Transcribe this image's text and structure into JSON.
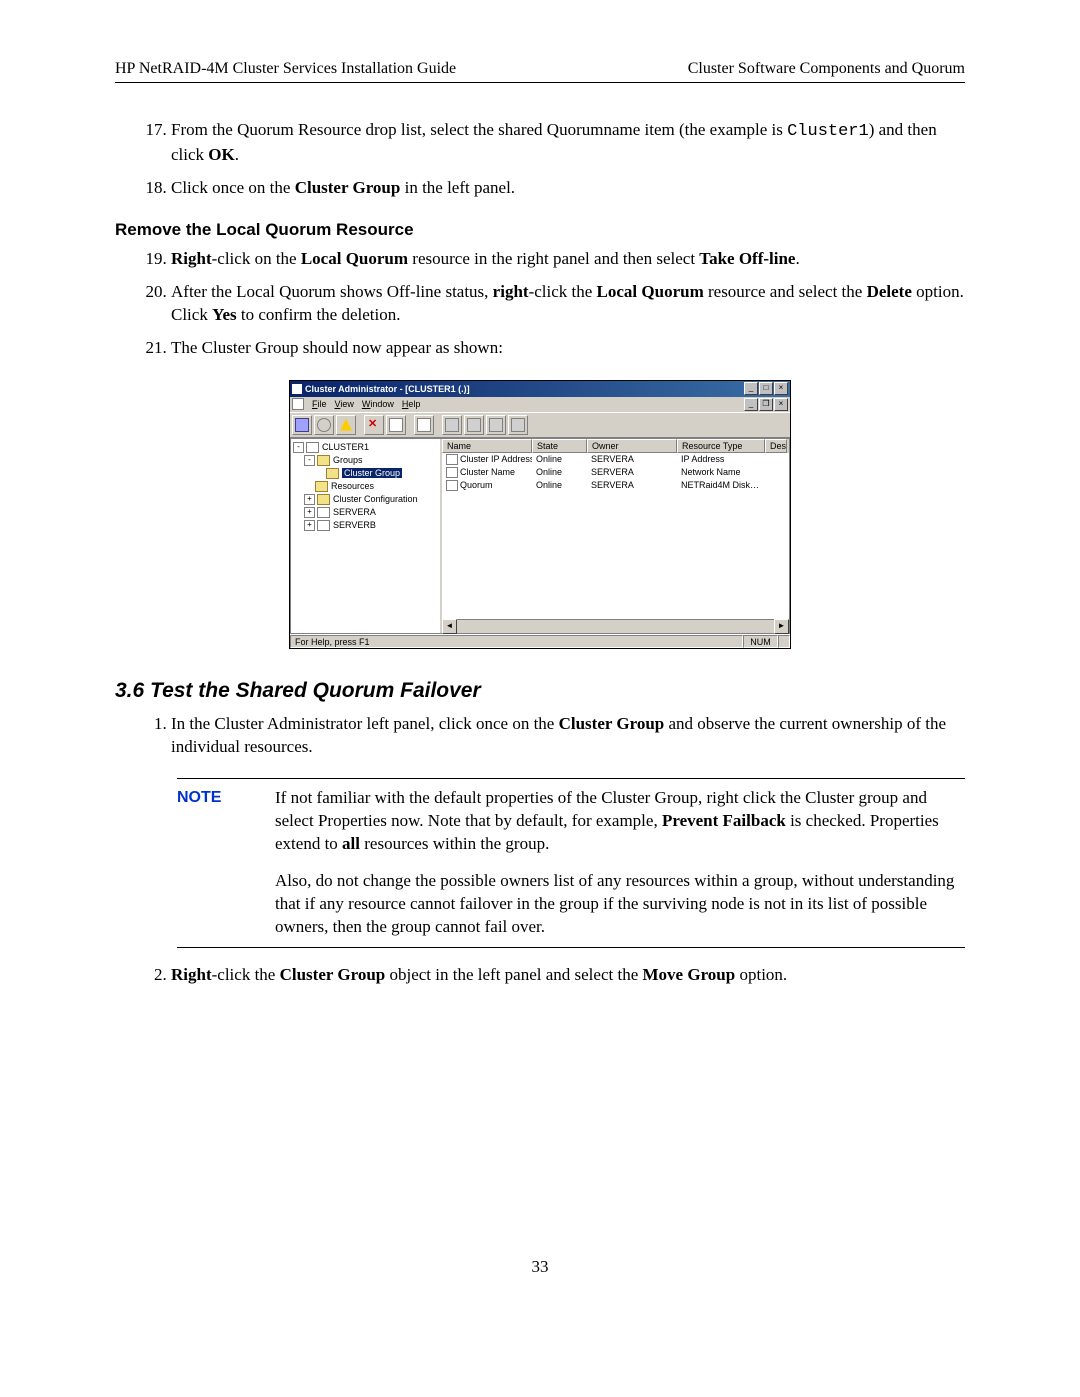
{
  "header": {
    "left": "HP NetRAID-4M Cluster Services Installation Guide",
    "right": "Cluster Software Components and Quorum"
  },
  "steps_a": {
    "s17_a": "From the Quorum Resource drop list, select the shared Quorumname item (the example is ",
    "s17_code": "Cluster1",
    "s17_b": ") and then click ",
    "s17_ok": "OK",
    "s17_c": ".",
    "s18_a": "Click once on the ",
    "s18_b": "Cluster Group",
    "s18_c": " in the left panel."
  },
  "sub_heading": "Remove the Local Quorum Resource",
  "steps_b": {
    "s19_a": "Right",
    "s19_b": "-click on the ",
    "s19_c": "Local Quorum",
    "s19_d": " resource in the right panel and then select ",
    "s19_e": "Take Off-line",
    "s19_f": ".",
    "s20_a": "After the Local Quorum shows Off-line status, ",
    "s20_b": "right",
    "s20_c": "-click the ",
    "s20_d": "Local Quorum",
    "s20_e": " resource and select the ",
    "s20_f": "Delete",
    "s20_g": " option.  Click ",
    "s20_h": "Yes",
    "s20_i": " to confirm the deletion.",
    "s21": "The Cluster Group should now appear as shown:"
  },
  "win": {
    "title": "Cluster Administrator - [CLUSTER1 (.)]",
    "menu": {
      "file": "File",
      "view": "View",
      "window": "Window",
      "help": "Help"
    },
    "tree": {
      "root": "CLUSTER1",
      "groups": "Groups",
      "cluster_group": "Cluster Group",
      "resources": "Resources",
      "cluster_config": "Cluster Configuration",
      "servera": "SERVERA",
      "serverb": "SERVERB"
    },
    "cols": {
      "name": "Name",
      "state": "State",
      "owner": "Owner",
      "type": "Resource Type",
      "desc": "Des"
    },
    "rows": [
      {
        "name": "Cluster IP Address",
        "state": "Online",
        "owner": "SERVERA",
        "type": "IP Address"
      },
      {
        "name": "Cluster Name",
        "state": "Online",
        "owner": "SERVERA",
        "type": "Network Name"
      },
      {
        "name": "Quorum",
        "state": "Online",
        "owner": "SERVERA",
        "type": "NETRaid4M Disk…"
      }
    ],
    "status": "For Help, press F1",
    "num": "NUM"
  },
  "section": "3.6  Test the Shared Quorum Failover",
  "steps_c": {
    "s1_a": "In the Cluster Administrator left panel, click once on the ",
    "s1_b": "Cluster Group",
    "s1_c": " and observe the current ownership of the individual resources."
  },
  "note": {
    "label": "NOTE",
    "p1_a": "If not familiar with the default properties of the Cluster Group, right click the Cluster group and select Properties now. Note that by default, for example, ",
    "p1_b": "Prevent Failback",
    "p1_c": " is checked.  Properties extend to ",
    "p1_d": "all",
    "p1_e": " resources within the group.",
    "p2": "Also,  do not change the possible owners list of any resources within a group, without understanding that if any resource cannot failover in the group if the surviving node is not in its list of possible owners, then the group cannot fail over."
  },
  "steps_d": {
    "s2_a": "Right",
    "s2_b": "-click the ",
    "s2_c": "Cluster Group",
    "s2_d": " object in the left panel and select the ",
    "s2_e": "Move Group",
    "s2_f": " option."
  },
  "page_number": "33"
}
